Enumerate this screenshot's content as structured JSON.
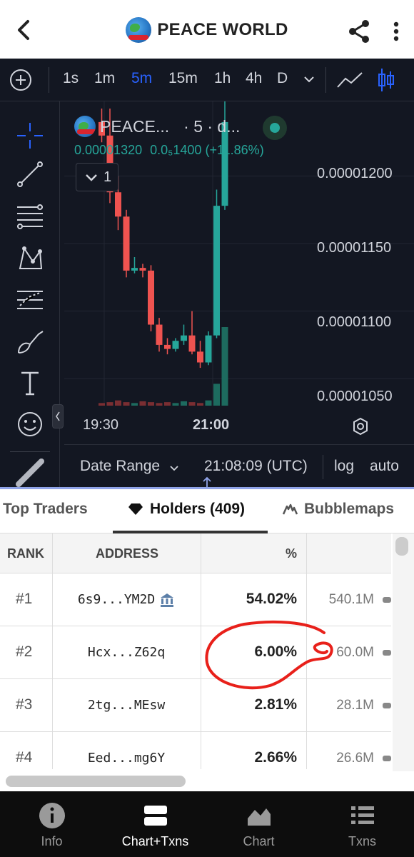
{
  "header": {
    "title": "PEACE WORLD",
    "logo": "peace-world-globe-logo"
  },
  "chart_toolbar": {
    "timeframes": [
      "1s",
      "1m",
      "5m",
      "15m",
      "1h",
      "4h",
      "D"
    ],
    "active_timeframe": "5m",
    "accent_color": "#2962ff"
  },
  "legend": {
    "name": "PEACE...",
    "interval": "· 5 · d...",
    "price": "0.00001320",
    "price_alt": "0.0₅1400",
    "change": "(+11.86%)",
    "collapse_count": "1",
    "up_color": "#26a69a"
  },
  "axis": {
    "prices": [
      "0.00001200",
      "0.00001150",
      "0.00001100",
      "0.00001050"
    ],
    "times": [
      "19:30",
      "21:00"
    ]
  },
  "chart_bottom": {
    "date_range": "Date Range",
    "time": "21:08:09 (UTC)",
    "log": "log",
    "auto": "auto"
  },
  "chart_data": {
    "type": "candlestick",
    "title": "",
    "ylim": [
      1.03e-05,
      1.25e-05
    ],
    "up_color": "#26a69a",
    "down_color": "#ef5350",
    "candles": [
      {
        "o": 1.24e-05,
        "c": 1.23e-05,
        "h": 1.25e-05,
        "l": 1.225e-05,
        "dir": "down"
      },
      {
        "o": 1.23e-05,
        "c": 1.188e-05,
        "h": 1.25e-05,
        "l": 1.18e-05,
        "dir": "down"
      },
      {
        "o": 1.188e-05,
        "c": 1.17e-05,
        "h": 1.2e-05,
        "l": 1.16e-05,
        "dir": "down"
      },
      {
        "o": 1.17e-05,
        "c": 1.13e-05,
        "h": 1.175e-05,
        "l": 1.125e-05,
        "dir": "down"
      },
      {
        "o": 1.13e-05,
        "c": 1.132e-05,
        "h": 1.14e-05,
        "l": 1.128e-05,
        "dir": "up"
      },
      {
        "o": 1.132e-05,
        "c": 1.13e-05,
        "h": 1.135e-05,
        "l": 1.125e-05,
        "dir": "down"
      },
      {
        "o": 1.13e-05,
        "c": 1.09e-05,
        "h": 1.134e-05,
        "l": 1.085e-05,
        "dir": "down"
      },
      {
        "o": 1.09e-05,
        "c": 1.075e-05,
        "h": 1.095e-05,
        "l": 1.07e-05,
        "dir": "down"
      },
      {
        "o": 1.075e-05,
        "c": 1.072e-05,
        "h": 1.08e-05,
        "l": 1.068e-05,
        "dir": "down"
      },
      {
        "o": 1.072e-05,
        "c": 1.078e-05,
        "h": 1.08e-05,
        "l": 1.07e-05,
        "dir": "up"
      },
      {
        "o": 1.078e-05,
        "c": 1.082e-05,
        "h": 1.09e-05,
        "l": 1.075e-05,
        "dir": "up"
      },
      {
        "o": 1.082e-05,
        "c": 1.07e-05,
        "h": 1.1e-05,
        "l": 1.068e-05,
        "dir": "down"
      },
      {
        "o": 1.07e-05,
        "c": 1.062e-05,
        "h": 1.078e-05,
        "l": 1.058e-05,
        "dir": "down"
      },
      {
        "o": 1.062e-05,
        "c": 1.082e-05,
        "h": 1.085e-05,
        "l": 1.06e-05,
        "dir": "up"
      },
      {
        "o": 1.082e-05,
        "c": 1.178e-05,
        "h": 1.19e-05,
        "l": 1.08e-05,
        "dir": "up"
      },
      {
        "o": 1.178e-05,
        "c": 1.24e-05,
        "h": 1.26e-05,
        "l": 1.175e-05,
        "dir": "up"
      }
    ],
    "volumes": [
      0.3,
      0.4,
      0.6,
      0.4,
      0.3,
      0.5,
      0.4,
      0.3,
      0.4,
      0.3,
      0.5,
      0.4,
      0.3,
      0.6,
      2.5,
      9.0
    ]
  },
  "tabs": {
    "top_traders": "Top Traders",
    "holders": "Holders (409)",
    "bubblemaps": "Bubblemaps"
  },
  "table": {
    "headers": {
      "rank": "RANK",
      "address": "ADDRESS",
      "pct": "%"
    },
    "rows": [
      {
        "rank": "#1",
        "address": "6s9...YM2D",
        "pct": "54.02%",
        "amount": "540.1M",
        "badge": "bank-icon"
      },
      {
        "rank": "#2",
        "address": "Hcx...Z62q",
        "pct": "6.00%",
        "amount": "60.0M"
      },
      {
        "rank": "#3",
        "address": "2tg...MEsw",
        "pct": "2.81%",
        "amount": "28.1M"
      },
      {
        "rank": "#4",
        "address": "Eed...mg6Y",
        "pct": "2.66%",
        "amount": "26.6M"
      }
    ],
    "highlight_color": "#e8201a"
  },
  "bottom_nav": {
    "items": [
      "Info",
      "Chart+Txns",
      "Chart",
      "Txns"
    ],
    "active": "Chart+Txns"
  }
}
